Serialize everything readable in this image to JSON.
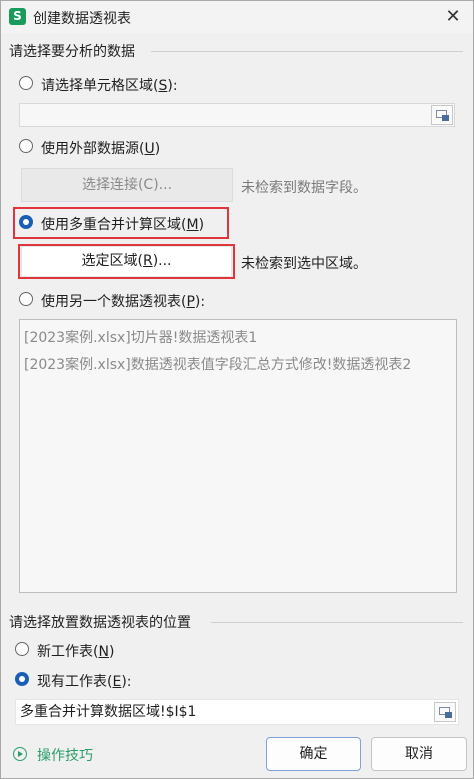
{
  "window": {
    "app_icon": "S",
    "title": "创建数据透视表",
    "close_glyph": "✕"
  },
  "source_group": {
    "title": "请选择要分析的数据"
  },
  "options": {
    "cell_range": {
      "label": "请选择单元格区域(",
      "key": "S",
      "tail": "):",
      "checked": false
    },
    "external": {
      "label": "使用外部数据源(",
      "key": "U",
      "tail": ")",
      "checked": false
    },
    "multi_range": {
      "label": "使用多重合并计算区域(",
      "key": "M",
      "tail": ")",
      "checked": true
    },
    "other_pivot": {
      "label": "使用另一个数据透视表(",
      "key": "P",
      "tail": "):",
      "checked": false
    }
  },
  "select_connection": {
    "label": "选择连接(C)...",
    "hint": "未检索到数据字段。"
  },
  "select_range": {
    "label_pre": "选定区域(",
    "key": "R",
    "label_post": ")...",
    "hint": "未检索到选中区域。"
  },
  "pivot_list": [
    "[2023案例.xlsx]切片器!数据透视表1",
    "[2023案例.xlsx]数据透视表值字段汇总方式修改!数据透视表2"
  ],
  "placement_group": {
    "title": "请选择放置数据透视表的位置"
  },
  "placement": {
    "new_sheet": {
      "label": "新工作表(",
      "key": "N",
      "tail": ")",
      "checked": false
    },
    "existing_sheet": {
      "label": "现有工作表(",
      "key": "E",
      "tail": "):",
      "checked": true
    },
    "location_value": "多重合并计算数据区域!$I$1"
  },
  "footer": {
    "tips": "操作技巧",
    "ok": "确定",
    "cancel": "取消"
  },
  "colors": {
    "accent": "#1a5fb4",
    "highlight_border": "#e0353a",
    "brand_green": "#1a9b5c"
  }
}
